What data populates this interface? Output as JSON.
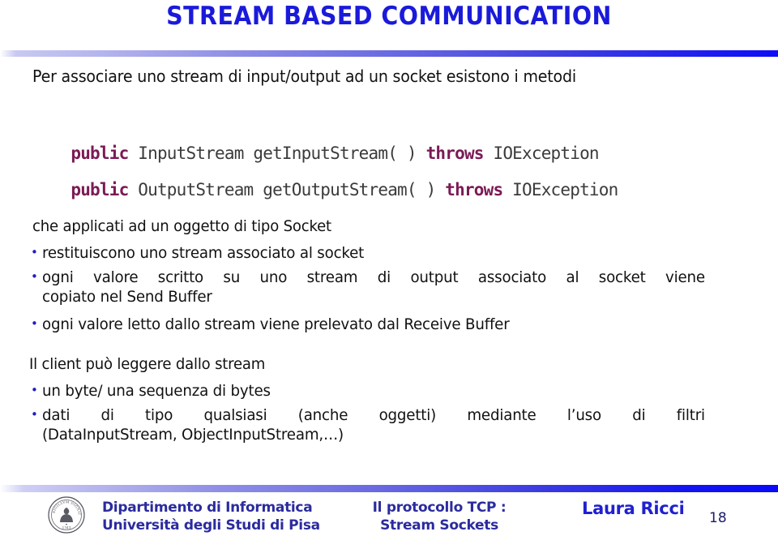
{
  "slide": {
    "title": "STREAM BASED COMMUNICATION",
    "title_color": "#1A1ADB",
    "intro": "Per associare uno stream di input/output ad un socket esistono i metodi",
    "code": [
      {
        "kw1": "public",
        "sig": " InputStream getInputStream( ) ",
        "kw2": "throws",
        "tail": " IOException"
      },
      {
        "kw1": "public",
        "sig": " OutputStream getOutputStream( ) ",
        "kw2": "throws",
        "tail": " IOException"
      }
    ],
    "section1_lead": "che applicati ad un oggetto di tipo Socket",
    "section1_bullets": [
      {
        "marker": "•",
        "line1": "restituiscono uno stream associato al socket",
        "line2": ""
      },
      {
        "marker": "•",
        "line1": "ogni valore scritto su uno stream di output associato al socket viene",
        "line2": "copiato nel  Send Buffer"
      },
      {
        "marker": "•",
        "line1": "ogni valore letto dallo stream viene prelevato dal Receive Buffer",
        "line2": ""
      }
    ],
    "section2_lead": "Il client può leggere dallo stream",
    "section2_bullets": [
      {
        "marker": "•",
        "line1": "un byte/ una sequenza di bytes",
        "line2": ""
      },
      {
        "marker": "•",
        "line1": "dati di tipo qualsiasi (anche oggetti) mediante l’uso di filtri",
        "line2": "(DataInputStream, ObjectInputStream,…)"
      }
    ],
    "bullet_color": "#2020C0",
    "code_keyword_color": "#7B1A55"
  },
  "footer": {
    "dept_line1": "Dipartimento di Informatica",
    "dept_line2": "Università degli Studi di Pisa",
    "topic_line1": "Il protocollo TCP :",
    "topic_line2": "Stream Sockets",
    "author": "Laura Ricci",
    "page_number": "18",
    "seal_text": "SIGILLVM DIGNITATIS",
    "seal_year": "1343",
    "text_color": "#2B2B9E",
    "author_color": "#2020D0"
  }
}
